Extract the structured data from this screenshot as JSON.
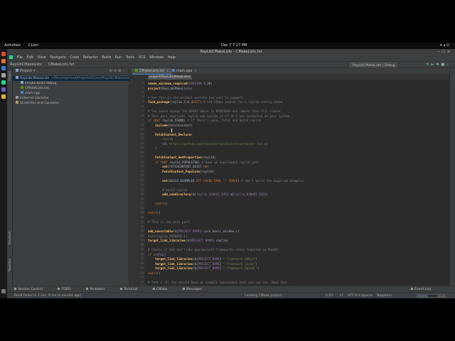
{
  "gnome": {
    "activities": "Activities",
    "app_name": "CLion",
    "clock": "Dec 7  7:17 PM"
  },
  "window": {
    "title": "RayLibCMakeLists – CMakeLists.txt"
  },
  "menu": [
    "File",
    "Edit",
    "View",
    "Navigate",
    "Code",
    "Refactor",
    "Build",
    "Run",
    "Tools",
    "VCS",
    "Window",
    "Help"
  ],
  "navbar": {
    "project": "RayLibCMakeLists",
    "file": "CMakeLists.txt",
    "run_config": "RayLibCMakeLists | Debug"
  },
  "project_panel": {
    "title": "Project",
    "rows": [
      {
        "label": "RayLibCMakeLists",
        "path": "~/Development/Projects/CLion/RayLibCMakeLists",
        "indent": 0,
        "icon": "folder-icon",
        "selected": true
      },
      {
        "label": "cmake-build-debug",
        "path": "",
        "indent": 1,
        "icon": "folder-icon",
        "selected": false
      },
      {
        "label": "CMakeLists.txt",
        "path": "",
        "indent": 1,
        "icon": "cmake-file-icon",
        "selected": false
      },
      {
        "label": "main.cpp",
        "path": "",
        "indent": 1,
        "icon": "cpp-file-icon",
        "selected": false
      },
      {
        "label": "External Libraries",
        "path": "",
        "indent": 0,
        "icon": "library-icon",
        "selected": false
      },
      {
        "label": "Scratches and Consoles",
        "path": "",
        "indent": 0,
        "icon": "scratch-icon",
        "selected": false
      }
    ]
  },
  "side_labels": {
    "project": "Project",
    "structure": "Structure",
    "favorites": "Favorites"
  },
  "tabs": [
    {
      "label": "CMakeLists.txt",
      "active": true
    },
    {
      "label": "main.cpp",
      "active": false
    }
  ],
  "breadcrumb": "project(RayLibCMakeLists)",
  "code_lines": [
    {
      "n": "1",
      "html": "<span class='fn'>cmake_minimum_required</span>(<span class='var'>VERSION</span> 3.20)"
    },
    {
      "n": "2",
      "html": "<span class='fn'>project</span>(RayLibCMakeLists)"
    },
    {
      "n": "3",
      "html": ""
    },
    {
      "n": "4",
      "html": "<span class='cmt'># Set this to the minimal version you want to support</span>"
    },
    {
      "n": "5",
      "html": "<span class='fn'>find_package</span>(raylib 3.0 <span class='kw'>QUIET</span>) <span class='cmt'># Let CMake search for a raylib-config.cmake</span>"
    },
    {
      "n": "6",
      "html": ""
    },
    {
      "n": "7",
      "html": "<span class='cmt'># You could change the QUIET above to REQUIRED and remove this if() clause</span>"
    },
    {
      "n": "8",
      "html": "<span class='cmt'># This part downloads raylib and builds it if it's not installed on your system</span>"
    },
    {
      "n": "9",
      "html": "<span class='kw'>if</span> (<span class='kw'>NOT</span> raylib_FOUND) <span class='cmt'># If there's none, fetch and build raylib</span>"
    },
    {
      "n": "10",
      "html": "    <span class='fn'>include</span>(FetchContent)"
    },
    {
      "n": "11",
      "html": ""
    },
    {
      "n": "12",
      "html": "    <span class='fn'>FetchContent_Declare</span>("
    },
    {
      "n": "13",
      "html": "        <span class='str'>raylib</span>"
    },
    {
      "n": "14",
      "html": "        <span class='var'>URL</span> <span class='str'>https://github.com/raysan5/raylib/archive/master.tar.gz</span>"
    },
    {
      "n": "15",
      "html": "    )"
    },
    {
      "n": "16",
      "html": ""
    },
    {
      "n": "17",
      "html": "    <span class='fn'>FetchContent_GetProperties</span>(raylib)"
    },
    {
      "n": "18",
      "html": "    <span class='kw'>if</span> (<span class='kw'>NOT</span> raylib_POPULATED) <span class='cmt'># Have we downloaded raylib yet?</span>"
    },
    {
      "n": "19",
      "html": "        <span class='fn'>set</span>(FETCHCONTENT_QUIET <span class='kw'>NO</span>)"
    },
    {
      "n": "20",
      "html": "        <span class='fn'>FetchContent_Populate</span>(raylib)"
    },
    {
      "n": "21",
      "html": ""
    },
    {
      "n": "22",
      "html": "        <span class='fn'>set</span>(BUILD_EXAMPLES <span class='kw'>OFF CACHE BOOL</span> <span class='str'>\"\"</span> <span class='kw'>FORCE</span>) <span class='cmt'># don't build the supplied examples</span>"
    },
    {
      "n": "23",
      "html": ""
    },
    {
      "n": "24",
      "html": "        <span class='cmt'># build raylib</span>"
    },
    {
      "n": "25",
      "html": "        <span class='fn'>add_subdirectory</span>(${<span class='var'>raylib_SOURCE_DIR</span>} ${<span class='var'>raylib_BINARY_DIR</span>})"
    },
    {
      "n": "26",
      "html": ""
    },
    {
      "n": "27",
      "html": "    <span class='kw'>endif</span>()"
    },
    {
      "n": "28",
      "html": ""
    },
    {
      "n": "29",
      "html": "<span class='kw'>endif</span>()"
    },
    {
      "n": "30",
      "html": ""
    },
    {
      "n": "31",
      "html": "<span class='cmt'># This is the main part:</span>"
    },
    {
      "n": "32",
      "html": ""
    },
    {
      "n": "33",
      "html": "<span class='fn'>add_executable</span>(${<span class='var'>PROJECT_NAME</span>} core_basic_window.c)"
    },
    {
      "n": "34",
      "html": "<span class='cmt'>#set(raylib_VERBOSE 1)</span>"
    },
    {
      "n": "35",
      "html": "<span class='fn'>target_link_libraries</span>(${<span class='var'>PROJECT_NAME</span>} raylib)"
    },
    {
      "n": "36",
      "html": ""
    },
    {
      "n": "37",
      "html": "<span class='cmt'># Checks if OSX and links appropriate frameworks (Only required on MacOS)</span>"
    },
    {
      "n": "38",
      "html": "<span class='kw'>if</span> (<span class='var'>APPLE</span>)"
    },
    {
      "n": "39",
      "html": "    <span class='fn'>target_link_libraries</span>(${<span class='var'>PROJECT_NAME</span>} <span class='str'>\"-framework IOKit\"</span>)"
    },
    {
      "n": "40",
      "html": "    <span class='fn'>target_link_libraries</span>(${<span class='var'>PROJECT_NAME</span>} <span class='str'>\"-framework Cocoa\"</span>)"
    },
    {
      "n": "41",
      "html": "    <span class='fn'>target_link_libraries</span>(${<span class='var'>PROJECT_NAME</span>} <span class='str'>\"-framework OpenGL\"</span>)"
    },
    {
      "n": "42",
      "html": "<span class='kw'>endif</span>()"
    },
    {
      "n": "43",
      "html": ""
    },
    {
      "n": "44",
      "html": "<span class='cmt'># That's it! You should have an example executable that you can run. Have fun!</span>"
    },
    {
      "n": "45",
      "html": ""
    }
  ],
  "tool_tabs": [
    "Version Control",
    "TODO",
    "Problems",
    "Terminal",
    "CMake",
    "Messages"
  ],
  "event_log": "Event Log",
  "status": {
    "message": "Build failed in 1 sec, 9 ms (a minute ago)",
    "loading": "Loading CMake project...",
    "position": "2:23",
    "line_sep": "LF",
    "encoding": "UTF-8",
    "indent": "4 spaces",
    "theme": "Nagatoro",
    "memory": "2000M",
    "memory_fraction": 0.36
  },
  "colors": {
    "accent": "#4a88c7",
    "clion_green": "#21d789"
  }
}
